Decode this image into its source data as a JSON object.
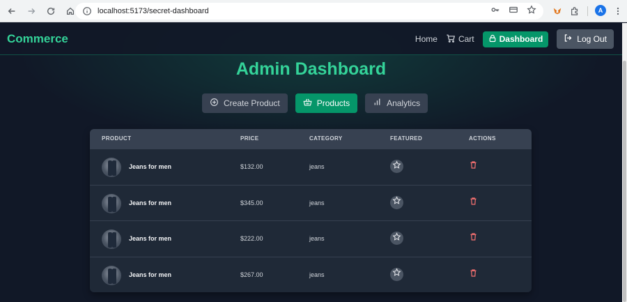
{
  "browser": {
    "url": "localhost:5173/secret-dashboard",
    "profile_initial": "A"
  },
  "app": {
    "brand": "Commerce",
    "nav": {
      "home": "Home",
      "cart": "Cart",
      "dashboard": "Dashboard",
      "logout": "Log Out"
    },
    "title": "Admin Dashboard",
    "tabs": [
      {
        "label": "Create Product",
        "icon": "plus-circle-icon",
        "active": false
      },
      {
        "label": "Products",
        "icon": "basket-icon",
        "active": true
      },
      {
        "label": "Analytics",
        "icon": "bar-chart-icon",
        "active": false
      }
    ],
    "table": {
      "headers": {
        "product": "PRODUCT",
        "price": "PRICE",
        "category": "CATEGORY",
        "featured": "FEATURED",
        "actions": "ACTIONS"
      },
      "rows": [
        {
          "name": "Jeans for men",
          "price": "$132.00",
          "category": "jeans"
        },
        {
          "name": "Jeans for men",
          "price": "$345.00",
          "category": "jeans"
        },
        {
          "name": "Jeans for men",
          "price": "$222.00",
          "category": "jeans"
        },
        {
          "name": "Jeans for men",
          "price": "$267.00",
          "category": "jeans"
        }
      ]
    }
  },
  "colors": {
    "accent": "#34d399",
    "primary_button": "#059669",
    "danger": "#f87171",
    "surface": "#1f2937",
    "background": "#111827"
  }
}
